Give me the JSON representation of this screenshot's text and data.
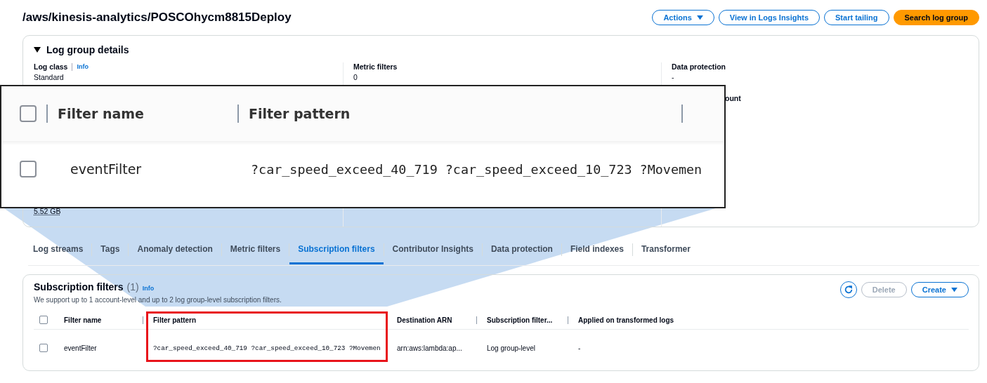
{
  "page_title": "/aws/kinesis-analytics/POSCOhycm8815Deploy",
  "header_buttons": [
    {
      "label": "Actions",
      "kind": "dropdown"
    },
    {
      "label": "View in Logs Insights",
      "kind": "normal"
    },
    {
      "label": "Start tailing",
      "kind": "normal"
    },
    {
      "label": "Search log group",
      "kind": "primary"
    }
  ],
  "details": {
    "title": "Log group details",
    "expanded": true,
    "fields": [
      {
        "label": "Log class",
        "info": "Info",
        "value": "Standard"
      },
      {
        "label": "Metric filters",
        "value": "0"
      },
      {
        "label": "Data protection",
        "value": "-"
      }
    ],
    "partial_label": "ount",
    "stored_bytes": "5.52 GB"
  },
  "tabs": [
    {
      "label": "Log streams",
      "selected": false
    },
    {
      "label": "Tags",
      "selected": false
    },
    {
      "label": "Anomaly detection",
      "selected": false
    },
    {
      "label": "Metric filters",
      "selected": false
    },
    {
      "label": "Subscription filters",
      "selected": true
    },
    {
      "label": "Contributor Insights",
      "selected": false
    },
    {
      "label": "Data protection",
      "selected": false
    },
    {
      "label": "Field indexes",
      "selected": false
    },
    {
      "label": "Transformer",
      "selected": false
    }
  ],
  "subscription": {
    "title": "Subscription filters",
    "count": "(1)",
    "info": "Info",
    "description": "We support up to 1 account-level and up to 2 log group-level subscription filters.",
    "buttons": [
      {
        "label": "Delete",
        "kind": "normal",
        "disabled": true
      },
      {
        "label": "Create",
        "kind": "dropdown",
        "disabled": false
      }
    ],
    "select_all_checked": false,
    "columns": [
      "Filter name",
      "Filter pattern",
      "Destination ARN",
      "Subscription filter...",
      "Applied on transformed logs"
    ],
    "rows": [
      {
        "selected": false,
        "cells": [
          "eventFilter",
          "?car_speed_exceed_40_719 ?car_speed_exceed_10_723 ?Movemen",
          "arn:aws:lambda:ap...",
          "Log group-level",
          "-"
        ]
      }
    ]
  },
  "zoom_inset": {
    "select_all_checked": false,
    "columns": [
      "Filter name",
      "Filter pattern"
    ],
    "row": {
      "selected": false,
      "cells": [
        "eventFilter",
        "?car_speed_exceed_40_719 ?car_speed_exceed_10_723 ?Movemen"
      ]
    }
  }
}
